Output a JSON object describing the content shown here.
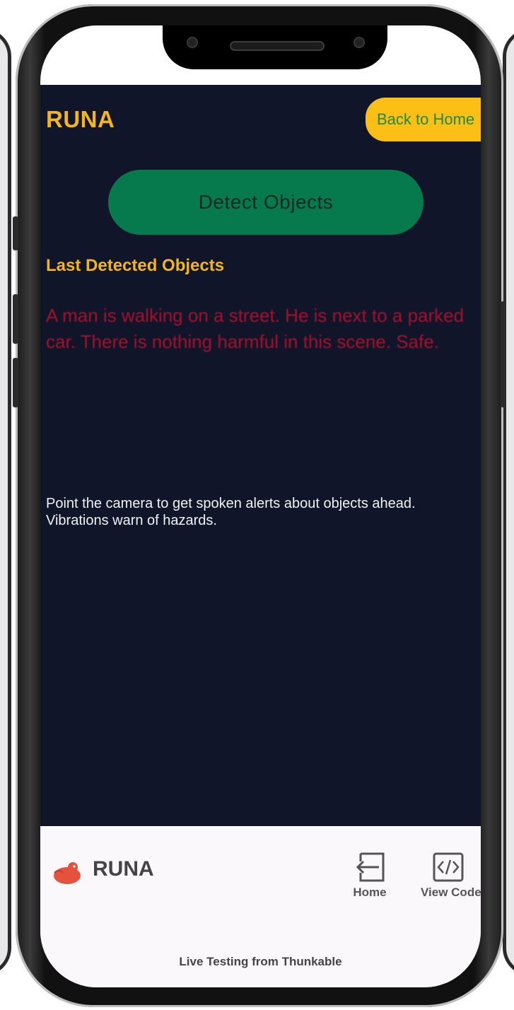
{
  "app": {
    "title": "RUNA",
    "back_button_label": "Back to Home",
    "detect_button_label": "Detect Objects",
    "section_heading": "Last Detected Objects",
    "detected_description": "A man is walking on a street. He is next to a parked car. There is nothing harmful in this scene. Safe.",
    "hint": "Point the camera to get spoken alerts about objects ahead. Vibrations warn of hazards."
  },
  "bottom_bar": {
    "brand_name": "RUNA",
    "nav": [
      {
        "label": "Home",
        "icon": "exit-arrow-icon"
      },
      {
        "label": "View Code",
        "icon": "code-icon"
      }
    ],
    "footer": "Live Testing from Thunkable"
  },
  "colors": {
    "app_background": "#11152a",
    "accent_yellow": "#f2b51f",
    "button_yellow": "#fbbf16",
    "button_green": "#067a4d",
    "alert_red": "#a5122b"
  }
}
